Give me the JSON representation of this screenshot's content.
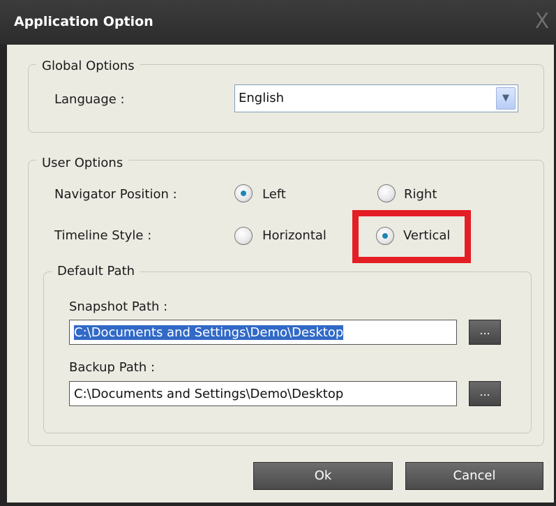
{
  "window": {
    "title": "Application Option",
    "close_glyph": "X"
  },
  "global": {
    "legend": "Global Options",
    "language_label": "Language :",
    "language_value": "English"
  },
  "user": {
    "legend": "User Options",
    "navigator_label": "Navigator Position :",
    "navigator_options": [
      "Left",
      "Right"
    ],
    "navigator_selected": "Left",
    "timeline_label": "Timeline Style :",
    "timeline_options": [
      "Horizontal",
      "Vertical"
    ],
    "timeline_selected": "Vertical"
  },
  "paths": {
    "legend": "Default Path",
    "snapshot_label": "Snapshot Path :",
    "snapshot_value": "C:\\Documents and Settings\\Demo\\Desktop",
    "backup_label": "Backup Path :",
    "backup_value": "C:\\Documents and Settings\\Demo\\Desktop",
    "browse_label": "..."
  },
  "buttons": {
    "ok": "Ok",
    "cancel": "Cancel"
  },
  "colors": {
    "highlight": "#e31e24",
    "radio_dot": "#1f86b6",
    "selection": "#3169c6"
  }
}
